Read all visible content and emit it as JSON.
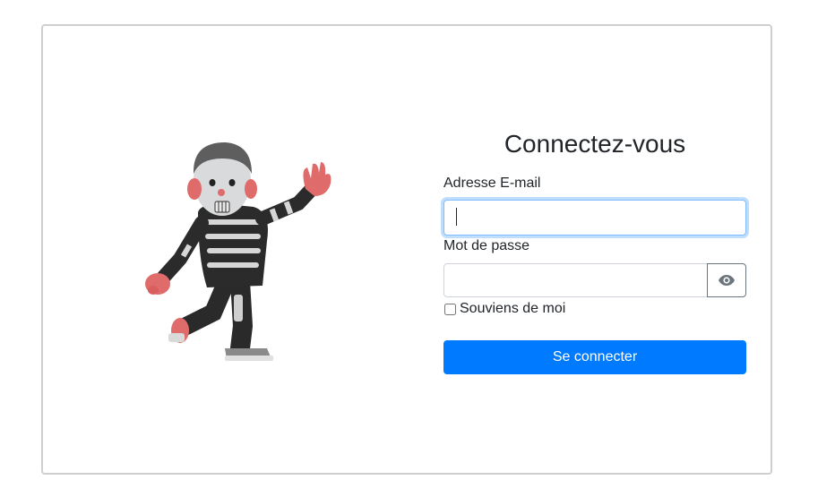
{
  "login": {
    "title": "Connectez-vous",
    "email_label": "Adresse E-mail",
    "email_value": "",
    "password_label": "Mot de passe",
    "password_value": "",
    "toggle_icon": "eye-icon",
    "remember_label": "Souviens de moi",
    "remember_checked": false,
    "submit_label": "Se connecter"
  },
  "colors": {
    "primary": "#007bff",
    "card_border": "#cfcfcf",
    "focus_border": "#80bdff",
    "icon": "#6c757d"
  }
}
